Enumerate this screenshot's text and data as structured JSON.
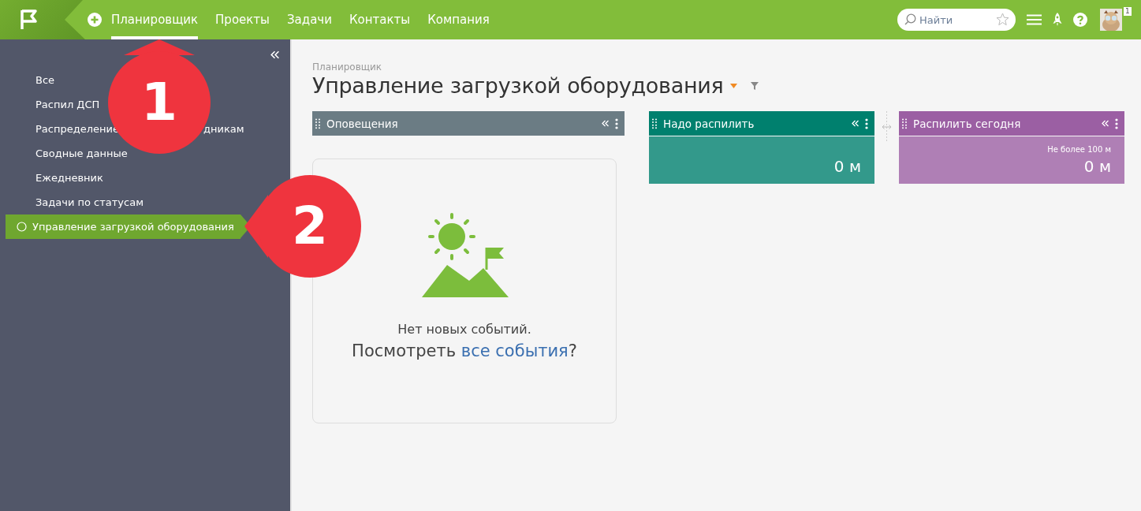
{
  "topbar": {
    "nav": [
      {
        "label": "Планировщик",
        "selected": true
      },
      {
        "label": "Проекты",
        "selected": false
      },
      {
        "label": "Задачи",
        "selected": false
      },
      {
        "label": "Контакты",
        "selected": false
      },
      {
        "label": "Компания",
        "selected": false
      }
    ],
    "search": {
      "placeholder": "Найти"
    },
    "notification_count": "1"
  },
  "sidebar": {
    "items": [
      {
        "label": "Все",
        "selected": false
      },
      {
        "label": "Распил ДСП",
        "selected": false
      },
      {
        "label": "Распределение",
        "label_tail": "дникам",
        "selected": false
      },
      {
        "label": "Сводные данные",
        "selected": false
      },
      {
        "label": "Ежедневник",
        "selected": false
      },
      {
        "label": "Задачи по статусам",
        "selected": false
      },
      {
        "label": "Управление загрузкой оборудования",
        "selected": true
      }
    ]
  },
  "page": {
    "breadcrumb": "Планировщик",
    "title": "Управление загрузкой оборудования"
  },
  "columns": [
    {
      "kind": "feed",
      "title": "Оповещения",
      "color": "#6b7c84",
      "empty": {
        "message": "Нет новых событий.",
        "prompt": "Посмотреть",
        "link": "все события",
        "suffix": "?"
      }
    },
    {
      "kind": "metric",
      "title": "Надо распилить",
      "color": "#00806e",
      "value": "0 м"
    },
    {
      "kind": "metric",
      "title": "Распилить сегодня",
      "color": "#9b5fa3",
      "note": "Не более 100 м",
      "value": "0 м"
    }
  ],
  "callouts": [
    {
      "number": "1"
    },
    {
      "number": "2"
    }
  ]
}
